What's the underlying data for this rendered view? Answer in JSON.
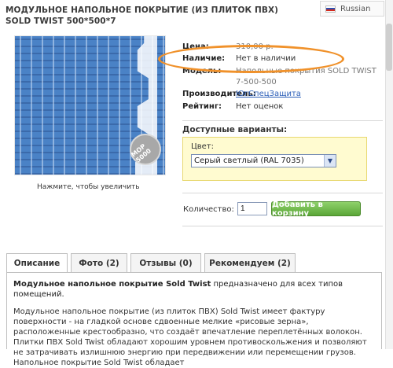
{
  "product": {
    "title": "МОДУЛЬНОЕ НАПОЛЬНОЕ ПОКРЫТИЕ (ИЗ ПЛИТОК ПВХ) SOLD TWIST 500*500*7",
    "image_caption": "Нажмите, чтобы увеличить",
    "image_badge": "MOP 5000"
  },
  "language": {
    "selected": "Russian",
    "flag_colors": [
      "#ffffff",
      "#2b4fb0",
      "#d52b1e"
    ]
  },
  "info": {
    "price_label": "Цена:",
    "price_value": "310,00 р.",
    "stock_label": "Наличие:",
    "stock_value": "Нет в наличии",
    "model_label": "Модель:",
    "model_value": "Напольные покрытия SOLD TWIST 7-500-500",
    "manufacturer_label": "Производитель:",
    "manufacturer_value": "ЮгСпецЗащита",
    "rating_label": "Рейтинг:",
    "rating_value": "Нет оценок"
  },
  "variants": {
    "title": "Доступные варианты:",
    "color_label": "Цвет:",
    "color_selected": "Серый светлый (RAL 7035)"
  },
  "cart": {
    "quantity_label": "Количество:",
    "quantity_value": "1",
    "add_button": "Добавить в корзину"
  },
  "tabs": [
    {
      "label": "Описание"
    },
    {
      "label": "Фото (2)"
    },
    {
      "label": "Отзывы (0)"
    },
    {
      "label": "Рекомендуем (2)"
    }
  ],
  "description": {
    "p1_bold": "Модульное напольное покрытие Sold Twist",
    "p1_rest": " предназначено для всех типов помещений.",
    "p2": "Модульное напольное покрытие (из плиток ПВХ) Sold Twist имеет фактуру поверхности - на гладкой основе сдвоенные мелкие «рисовые зерна», расположенные крестообразно, что создаёт впечатление переплетённых волокон. Плитки ПВХ Sold Twist обладают хорошим уровнем противоскольжения и позволяют не затрачивать излишнюю энергию при передвижении или перемещении грузов. Напольное покрытие Sold Twist обладает"
  },
  "colors": {
    "highlight": "#f0912a",
    "button_green": "#5aa637",
    "link": "#2c5fb8",
    "variants_bg": "#fffbd0"
  }
}
